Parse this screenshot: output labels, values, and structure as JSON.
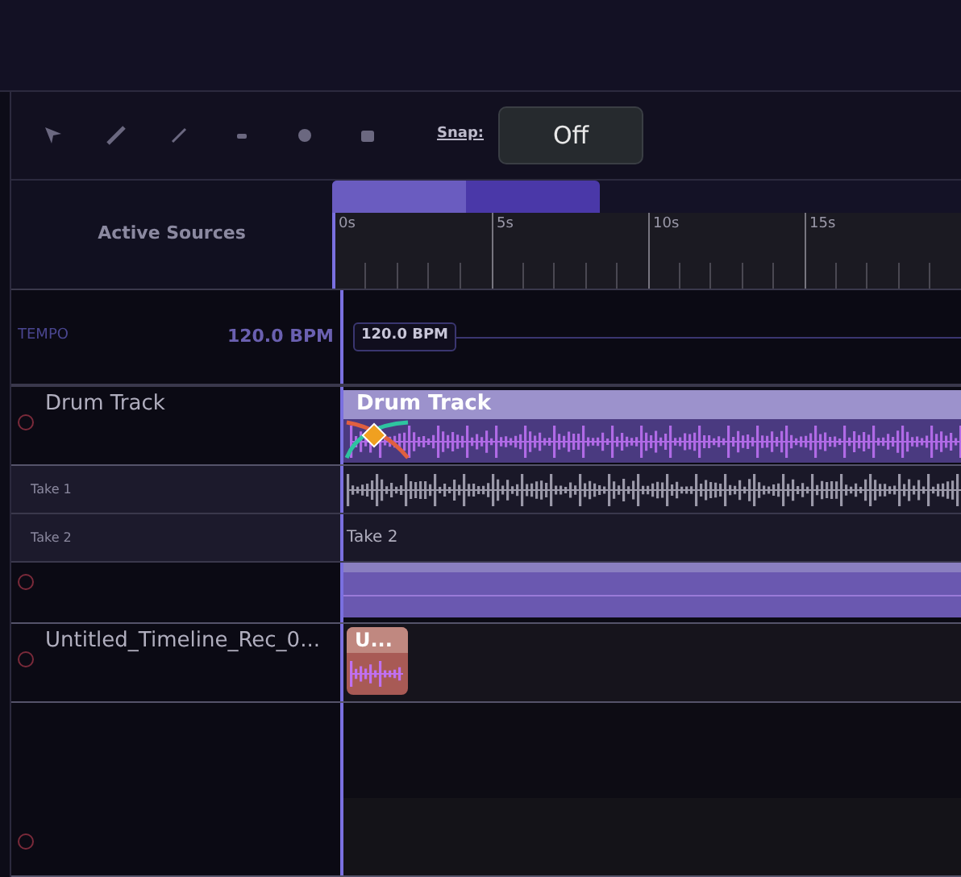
{
  "toolbar": {
    "snap_label": "Snap:",
    "snap_value": "Off"
  },
  "ruler": {
    "header": "Active Sources",
    "ticks": [
      "0s",
      "5s",
      "10s",
      "15s"
    ]
  },
  "tempo": {
    "label": "TEMPO",
    "value": "120.0 BPM",
    "marker": "120.0 BPM"
  },
  "tracks": [
    {
      "kind": "audio",
      "name": "Drum Track",
      "clip": "Drum Track",
      "color": "#9c92cc",
      "takes": [
        {
          "label": "Take 1",
          "waveform": true
        },
        {
          "label": "Take 2",
          "lane_label": "Take 2",
          "waveform": false
        }
      ]
    },
    {
      "kind": "audio",
      "color": "#6a58b0"
    },
    {
      "kind": "audio",
      "name": "Untitled_Timeline_Rec_0...",
      "clip": "U...",
      "color": "#a85a55"
    },
    {
      "kind": "empty"
    }
  ]
}
